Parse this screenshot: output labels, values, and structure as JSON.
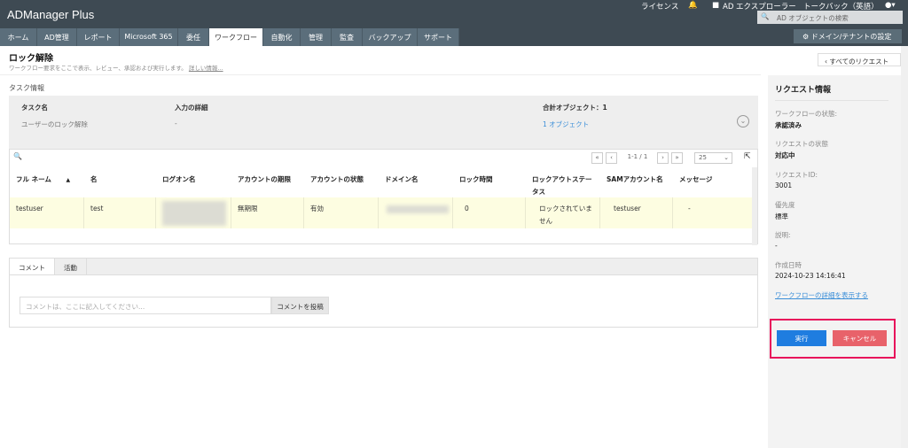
{
  "app": {
    "logo": "ADManager Plus"
  },
  "topbar": {
    "license": "ライセンス",
    "ad_explorer": "AD エクスプローラー",
    "talkback": "トークバック（英語）",
    "search_placeholder": "AD オブジェクトの検索",
    "domain_settings": "ドメイン/テナントの設定"
  },
  "tabs": [
    "ホーム",
    "AD管理",
    "レポート",
    "Microsoft 365",
    "委任",
    "ワークフロー",
    "自動化",
    "管理",
    "監査",
    "バックアップ",
    "サポート"
  ],
  "page": {
    "title": "ロック解除",
    "subtitle": "ワークフロー要求をここで表示、レビュー、承認および実行します。",
    "more_link": "詳しい情報...",
    "back": "すべてのリクエスト"
  },
  "task": {
    "section": "タスク情報",
    "headers": [
      "タスク名",
      "入力の詳細",
      "合計オブジェクト：1"
    ],
    "values": [
      "ユーザーのロック解除",
      "-",
      "1 オブジェクト"
    ]
  },
  "table": {
    "pagination": "1-1 / 1",
    "page_size": "25",
    "headers": [
      "フル ネーム",
      "名",
      "ログオン名",
      "アカウントの期限",
      "アカウントの状態",
      "ドメイン名",
      "ロック時間",
      "ロックアウトステータス",
      "SAMアカウント名",
      "メッセージ"
    ],
    "row": [
      "testuser",
      "test",
      "",
      "無期限",
      "有効",
      "",
      "0",
      "ロックされていません",
      "testuser",
      "-"
    ]
  },
  "comments": {
    "tabs": [
      "コメント",
      "活動"
    ],
    "placeholder": "コメントは、ここに記入してください...",
    "post": "コメントを投稿"
  },
  "side": {
    "title": "リクエスト情報",
    "fields": [
      {
        "label": "ワークフローの状態:",
        "value": "承認済み"
      },
      {
        "label": "リクエストの状態",
        "value": "対応中"
      },
      {
        "label": "リクエストID:",
        "value": "3001"
      },
      {
        "label": "優先度",
        "value": "標準"
      },
      {
        "label": "説明:",
        "value": "-"
      },
      {
        "label": "作成日時",
        "value": "2024-10-23 14:16:41"
      }
    ],
    "details_link": "ワークフローの詳細を表示する",
    "execute": "実行",
    "cancel": "キャンセル"
  },
  "colors": {
    "topbar": "#3e4a53",
    "tab": "#5b6e7b",
    "execute": "#1f7de0",
    "cancel": "#e8626a",
    "highlight": "#e8115b"
  }
}
